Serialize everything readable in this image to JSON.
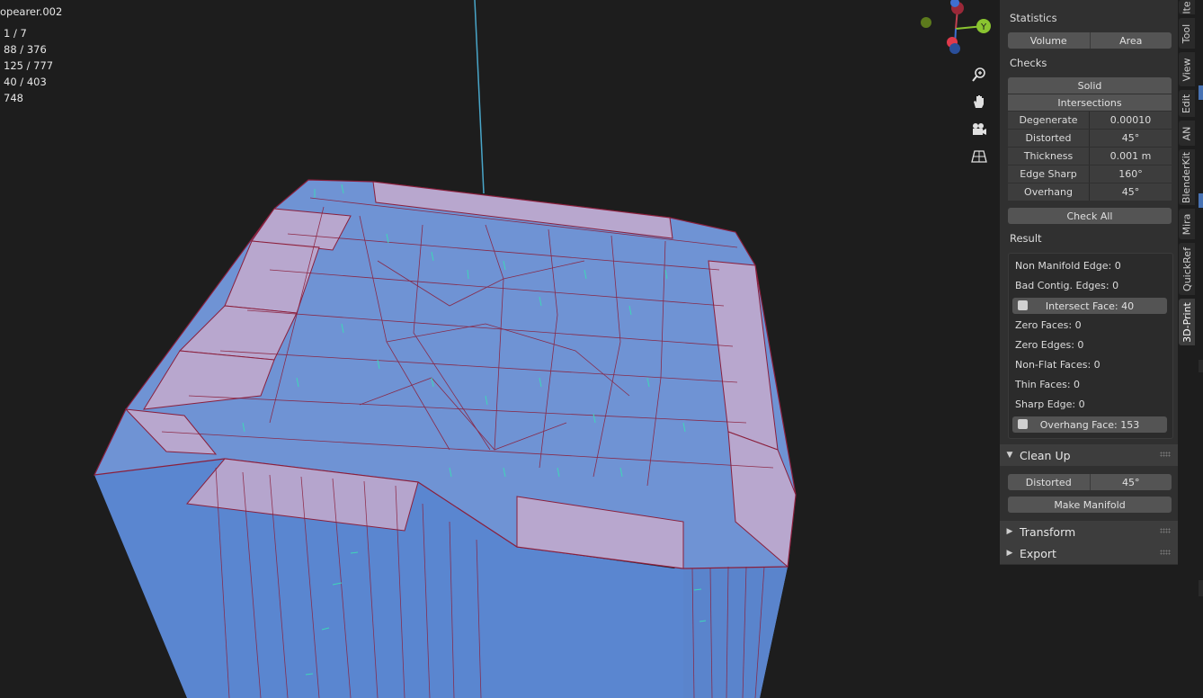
{
  "viewport": {
    "object_name": "opearer.002",
    "stats": [
      "1 / 7",
      "88 / 376",
      "125 / 777",
      "40 / 403",
      "748"
    ],
    "gizmo": {
      "y_label": "Y"
    }
  },
  "panel": {
    "statistics": {
      "title": "Statistics",
      "volume_label": "Volume",
      "area_label": "Area"
    },
    "checks": {
      "title": "Checks",
      "solid_label": "Solid",
      "intersections_label": "Intersections",
      "fields": [
        {
          "label": "Degenerate",
          "value": "0.00010"
        },
        {
          "label": "Distorted",
          "value": "45°"
        },
        {
          "label": "Thickness",
          "value": "0.001 m"
        },
        {
          "label": "Edge Sharp",
          "value": "160°"
        },
        {
          "label": "Overhang",
          "value": "45°"
        }
      ],
      "check_all_label": "Check All"
    },
    "result": {
      "title": "Result",
      "non_manifold": "Non Manifold Edge: 0",
      "bad_contig": "Bad Contig. Edges: 0",
      "intersect_face": "Intersect Face: 40",
      "zero_faces": "Zero Faces: 0",
      "zero_edges": "Zero Edges: 0",
      "non_flat": "Non-Flat Faces: 0",
      "thin_faces": "Thin Faces: 0",
      "sharp_edge": "Sharp Edge: 0",
      "overhang_face": "Overhang Face: 153"
    },
    "cleanup": {
      "title": "Clean Up",
      "distorted_label": "Distorted",
      "distorted_value": "45°",
      "make_manifold_label": "Make Manifold"
    },
    "transform": {
      "title": "Transform"
    },
    "export": {
      "title": "Export"
    }
  },
  "tabs": [
    "Ite",
    "Tool",
    "View",
    "Edit",
    "AN",
    "BlenderKit",
    "Mira",
    "QuickRef",
    "3D-Print"
  ],
  "colors": {
    "mesh_face": "#6f93d4",
    "mesh_edge": "#8a1f3c",
    "overhang_face": "#c8a8c8",
    "panel_bg": "#303030",
    "accent": "#4772b3"
  }
}
